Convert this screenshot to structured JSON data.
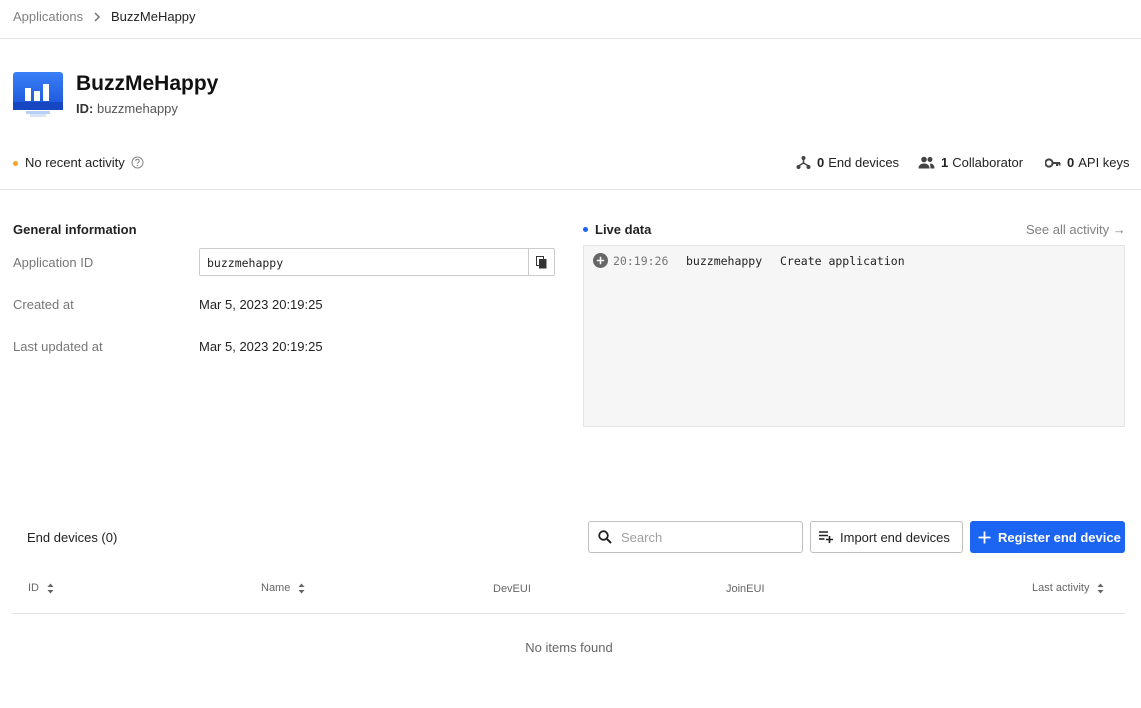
{
  "breadcrumb": {
    "parent": "Applications",
    "current": "BuzzMeHappy"
  },
  "app": {
    "name": "BuzzMeHappy",
    "id_label": "ID:",
    "id_value": "buzzmehappy"
  },
  "status": {
    "activity_text": "No recent activity",
    "activity_color": "#f5a623",
    "end_devices_count": "0",
    "end_devices_label": "End devices",
    "collaborators_count": "1",
    "collaborators_label": "Collaborator",
    "api_keys_count": "0",
    "api_keys_label": "API keys"
  },
  "general": {
    "title": "General information",
    "app_id_label": "Application ID",
    "app_id_value": "buzzmehappy",
    "created_label": "Created at",
    "created_value": "Mar 5, 2023 20:19:25",
    "updated_label": "Last updated at",
    "updated_value": "Mar 5, 2023 20:19:25"
  },
  "live": {
    "title": "Live data",
    "see_all": "See all activity →",
    "accent_color": "#1c64f2",
    "events": [
      {
        "time": "20:19:26",
        "entity": "buzzmehappy",
        "description": "Create application",
        "icon": "plus-circle-icon"
      }
    ]
  },
  "end_devices": {
    "title": "End devices (0)",
    "search_placeholder": "Search",
    "import_label": "Import end devices",
    "register_label": "Register end device",
    "columns": [
      "ID",
      "Name",
      "DevEUI",
      "JoinEUI",
      "Last activity"
    ],
    "empty_message": "No items found"
  }
}
